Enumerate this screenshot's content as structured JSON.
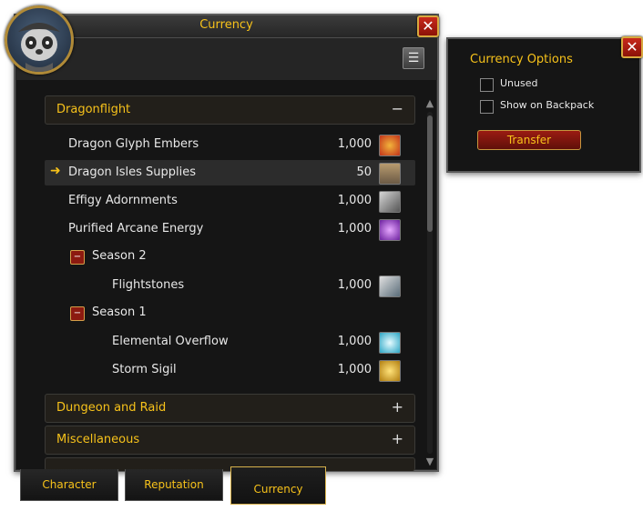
{
  "window": {
    "title": "Currency"
  },
  "icons": {
    "close": "close-icon",
    "settings": "settings-icon",
    "arrow": "arrow-icon"
  },
  "categories": [
    {
      "label": "Dragonflight",
      "state": "−"
    },
    {
      "label": "Dungeon and Raid",
      "state": "+"
    },
    {
      "label": "Miscellaneous",
      "state": "+"
    }
  ],
  "currencies": [
    {
      "name": "Dragon Glyph Embers",
      "amount": "1,000",
      "icon": "embers-icon",
      "color": "#c2321a"
    },
    {
      "name": "Dragon Isles Supplies",
      "amount": "50",
      "icon": "supplies-icon",
      "color": "#6b5a45"
    },
    {
      "name": "Effigy Adornments",
      "amount": "1,000",
      "icon": "effigy-icon",
      "color": "#8a8a8a"
    },
    {
      "name": "Purified Arcane Energy",
      "amount": "1,000",
      "icon": "arcane-icon",
      "color": "#9b3bd4"
    }
  ],
  "seasons": [
    {
      "label": "Season 2",
      "toggle": "−",
      "items": [
        {
          "name": "Flightstones",
          "amount": "1,000",
          "icon": "flightstones-icon",
          "color": "#a7a7a7"
        }
      ]
    },
    {
      "label": "Season 1",
      "toggle": "−",
      "items": [
        {
          "name": "Elemental Overflow",
          "amount": "1,000",
          "icon": "elemental-icon",
          "color": "#5ad1e3"
        },
        {
          "name": "Storm Sigil",
          "amount": "1,000",
          "icon": "sigil-icon",
          "color": "#d7a91a"
        }
      ]
    }
  ],
  "tabs": [
    "Character",
    "Reputation",
    "Currency"
  ],
  "active_tab": "Currency",
  "options": {
    "title": "Currency Options",
    "checkboxes": [
      "Unused",
      "Show on Backpack"
    ],
    "transfer": "Transfer"
  }
}
